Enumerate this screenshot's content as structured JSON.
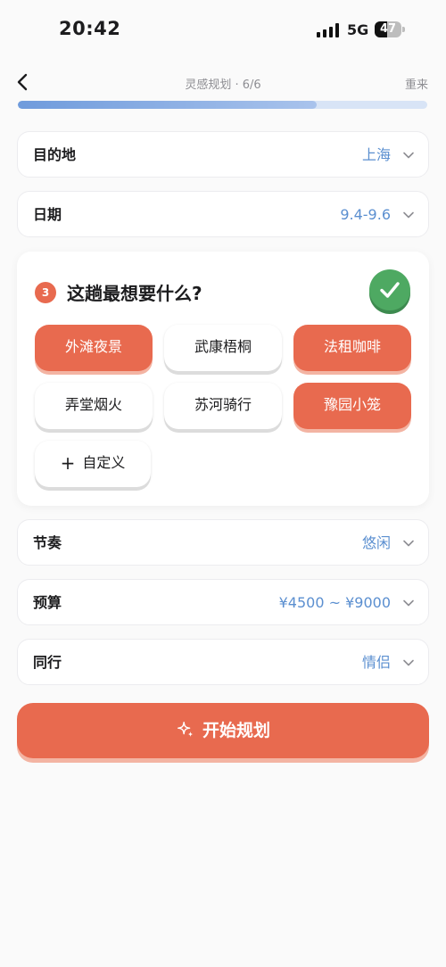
{
  "status": {
    "time": "20:42",
    "network": "5G",
    "battery": "47",
    "battery_level": 0.47
  },
  "nav": {
    "title": "灵感规划 · 6/6",
    "reset": "重来",
    "progress": 0.73
  },
  "rows": {
    "destination": {
      "label": "目的地",
      "value": "上海"
    },
    "date": {
      "label": "日期",
      "value": "9.4-9.6"
    },
    "pace": {
      "label": "节奏",
      "value": "悠闲"
    },
    "budget": {
      "label": "预算",
      "value": "¥4500 ~ ¥9000"
    },
    "companion": {
      "label": "同行",
      "value": "情侣"
    }
  },
  "question": {
    "number": "3",
    "text": "这趟最想要什么?",
    "options": [
      {
        "label": "外滩夜景",
        "selected": true
      },
      {
        "label": "武康梧桐",
        "selected": false
      },
      {
        "label": "法租咖啡",
        "selected": true
      },
      {
        "label": "弄堂烟火",
        "selected": false
      },
      {
        "label": "苏河骑行",
        "selected": false
      },
      {
        "label": "豫园小笼",
        "selected": true
      }
    ],
    "custom": "自定义"
  },
  "cta": {
    "label": "开始规划"
  },
  "colors": {
    "accent": "#e86a4f",
    "link": "#5b8fd0",
    "confirm": "#4ea962"
  }
}
